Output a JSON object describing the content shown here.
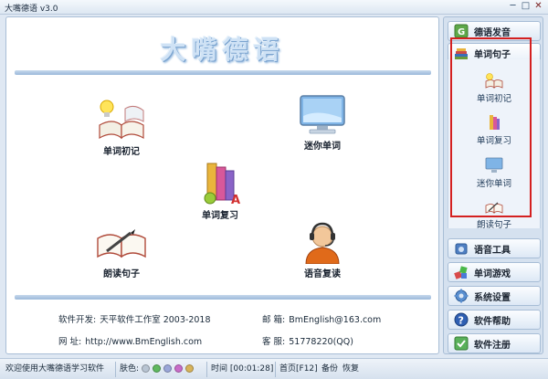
{
  "window": {
    "title": "大嘴德语 v3.0",
    "minimize": "─",
    "maximize": "□",
    "close": "✕"
  },
  "app": {
    "title": "大嘴德语"
  },
  "features": [
    {
      "label": "单词初记",
      "icon": "book-lightbulb-icon"
    },
    {
      "label": "迷你单词",
      "icon": "monitor-icon"
    },
    {
      "label": "单词复习",
      "icon": "books-stack-icon"
    },
    {
      "label": "朗读句子",
      "icon": "open-book-pen-icon"
    },
    {
      "label": "语音复读",
      "icon": "headset-person-icon"
    }
  ],
  "info": {
    "dev_label": "软件开发:",
    "dev_value": "天平软件工作室 2003-2018",
    "mail_label": "邮    箱:",
    "mail_value": "BmEnglish@163.com",
    "site_label": "网    址:",
    "site_value": "http://www.BmEnglish.com",
    "service_label": "客    服:",
    "service_value": "51778220(QQ)"
  },
  "sidebar": {
    "buttons_top": [
      {
        "label": "德语发音",
        "icon": "speaker-g-icon"
      },
      {
        "label": "单词句子",
        "icon": "books-icon"
      }
    ],
    "sub_items": [
      {
        "label": "单词初记",
        "icon": "lightbulb-book-icon"
      },
      {
        "label": "单词复习",
        "icon": "books-stack-icon"
      },
      {
        "label": "迷你单词",
        "icon": "monitor-icon"
      },
      {
        "label": "朗读句子",
        "icon": "open-book-icon"
      }
    ],
    "buttons_bottom": [
      {
        "label": "语音工具",
        "icon": "speaker-tool-icon"
      },
      {
        "label": "单词游戏",
        "icon": "game-blocks-icon"
      },
      {
        "label": "系统设置",
        "icon": "gear-icon"
      },
      {
        "label": "软件帮助",
        "icon": "help-icon"
      },
      {
        "label": "软件注册",
        "icon": "register-icon"
      }
    ]
  },
  "status": {
    "welcome": "欢迎使用大嘴德语学习软件",
    "skin_label": "肤色:",
    "skin_colors": [
      "#b8c4d2",
      "#5fb85f",
      "#9aa6d8",
      "#c86cc8",
      "#d7b35a"
    ],
    "time_label": "时间",
    "time_value": "[00:01:28]",
    "home": "首页[F12]",
    "backup": "备份",
    "restore": "恢复"
  }
}
